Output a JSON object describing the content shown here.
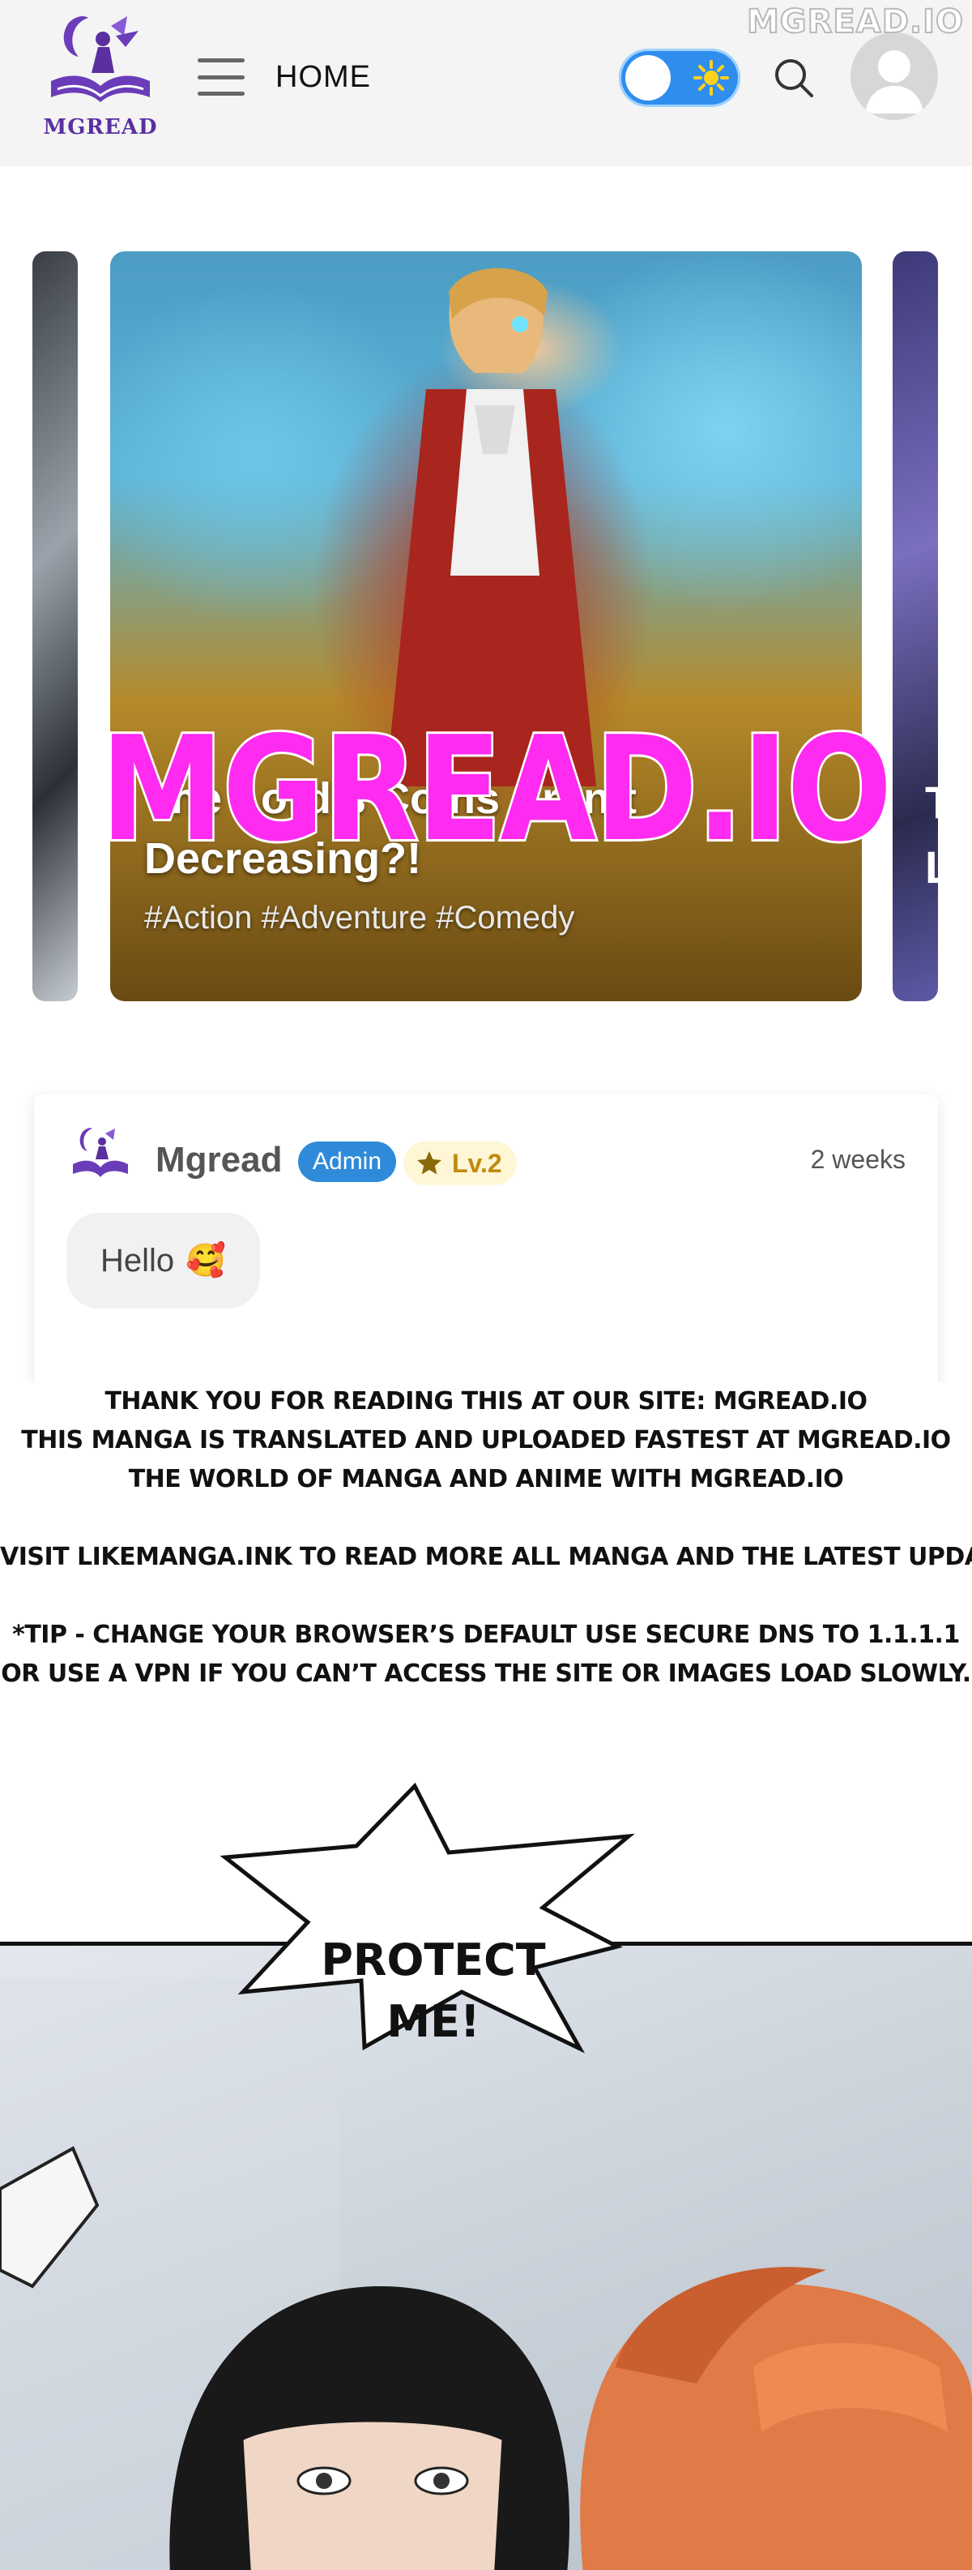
{
  "header": {
    "logo_text": "MGREAD",
    "nav_label": "HOME",
    "watermark": "MGREAD.IO"
  },
  "carousel": {
    "featured": {
      "title": "The Lord’s Coins Aren’t Decreasing?!",
      "tags": "#Action #Adventure #Comedy"
    },
    "side_right_letters": "T\nL",
    "promo_watermark": "MGREAD.IO"
  },
  "comment": {
    "author": "Mgread",
    "badge": "Admin",
    "level": "Lv.2",
    "time": "2 weeks",
    "message": "Hello",
    "emoji": "🥰"
  },
  "notice": {
    "lines": [
      "THANK YOU FOR READING THIS AT OUR SITE: MGREAD.IO",
      "THIS MANGA IS TRANSLATED AND UPLOADED FASTEST AT MGREAD.IO",
      "THE WORLD OF MANGA AND ANIME WITH MGREAD.IO",
      "VISIT LIKEMANGA.INK TO READ MORE ALL MANGA AND THE LATEST UPDATED CHAPTERS.",
      "*TIP - CHANGE YOUR BROWSER’S DEFAULT USE SECURE DNS TO 1.1.1.1",
      "OR USE A VPN IF YOU CAN’T ACCESS THE SITE OR IMAGES LOAD SLOWLY."
    ]
  },
  "comic": {
    "speech_line1": "PROTECT",
    "speech_line2": "ME!"
  },
  "colors": {
    "toggle": "#2f8dee",
    "badge": "#2f8bd9",
    "promo": "#ff2bf0",
    "logo": "#5a2fa0"
  }
}
